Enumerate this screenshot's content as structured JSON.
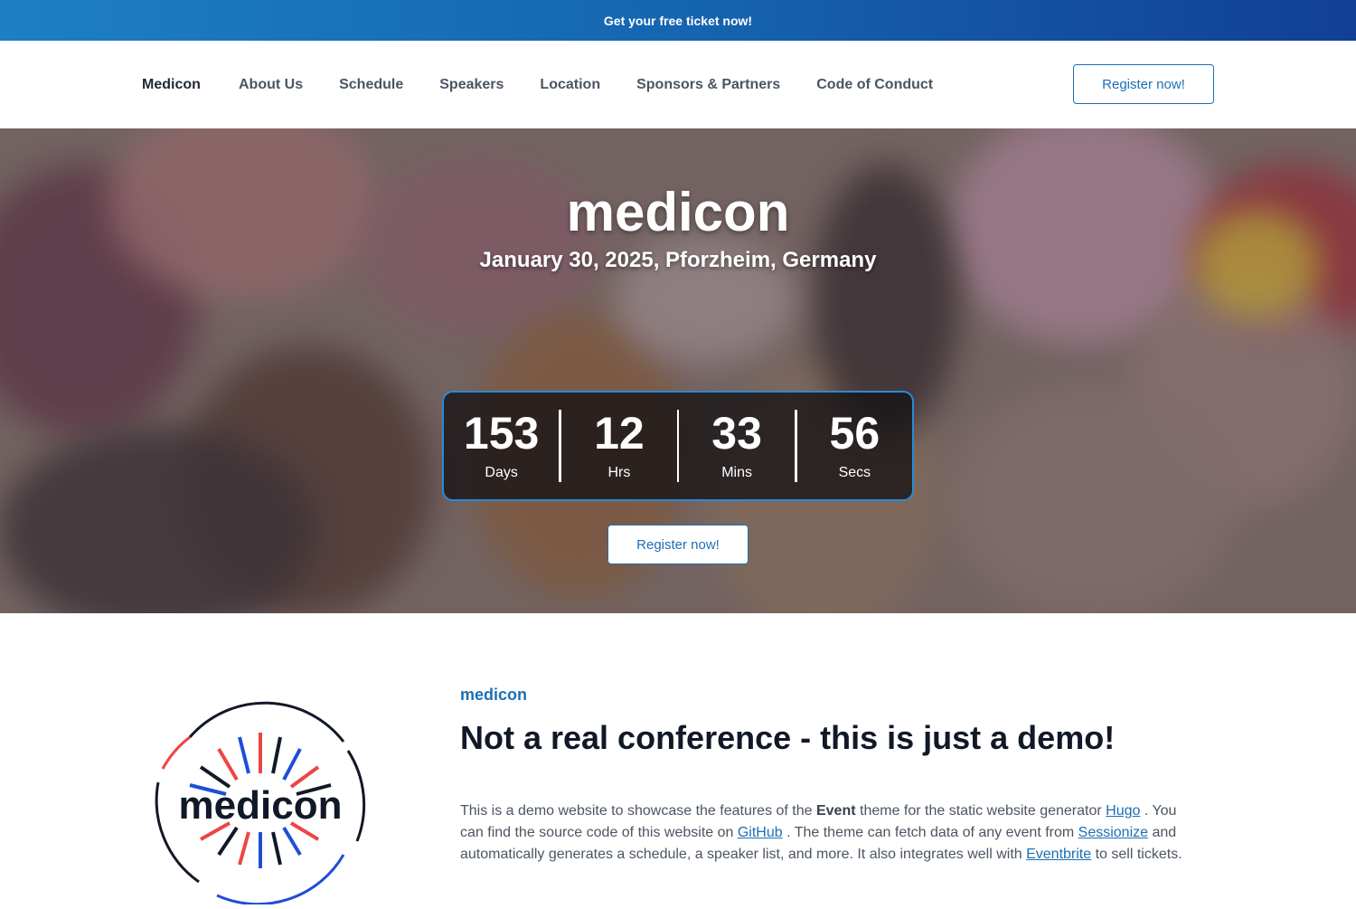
{
  "promo": {
    "text": "Get your free ticket now!"
  },
  "nav": {
    "brand": "Medicon",
    "links": [
      "About Us",
      "Schedule",
      "Speakers",
      "Location",
      "Sponsors & Partners",
      "Code of Conduct"
    ],
    "register": "Register now!"
  },
  "hero": {
    "title": "medicon",
    "subtitle": "January 30, 2025, Pforzheim, Germany",
    "countdown": [
      {
        "value": "153",
        "label": "Days"
      },
      {
        "value": "12",
        "label": "Hrs"
      },
      {
        "value": "33",
        "label": "Mins"
      },
      {
        "value": "56",
        "label": "Secs"
      }
    ],
    "register": "Register now!"
  },
  "about": {
    "logo_text": "medicon",
    "eyebrow": "medicon",
    "heading": "Not a real conference - this is just a demo!",
    "body": {
      "p1": "This is a demo website to showcase the features of the ",
      "event": "Event",
      "p2": " theme for the static website generator ",
      "hugo": "Hugo",
      "p3": " . You can find the source code of this website on ",
      "github": "GitHub",
      "p4": " . The theme can fetch data of any event from ",
      "sessionize": "Sessionize",
      "p5": " and automatically generates a schedule, a speaker list, and more. It also integrates well with ",
      "eventbrite": "Eventbrite",
      "p6": " to sell tickets."
    }
  },
  "colors": {
    "accent": "#1d6fb5",
    "countdown_border": "#2a8ad8"
  }
}
